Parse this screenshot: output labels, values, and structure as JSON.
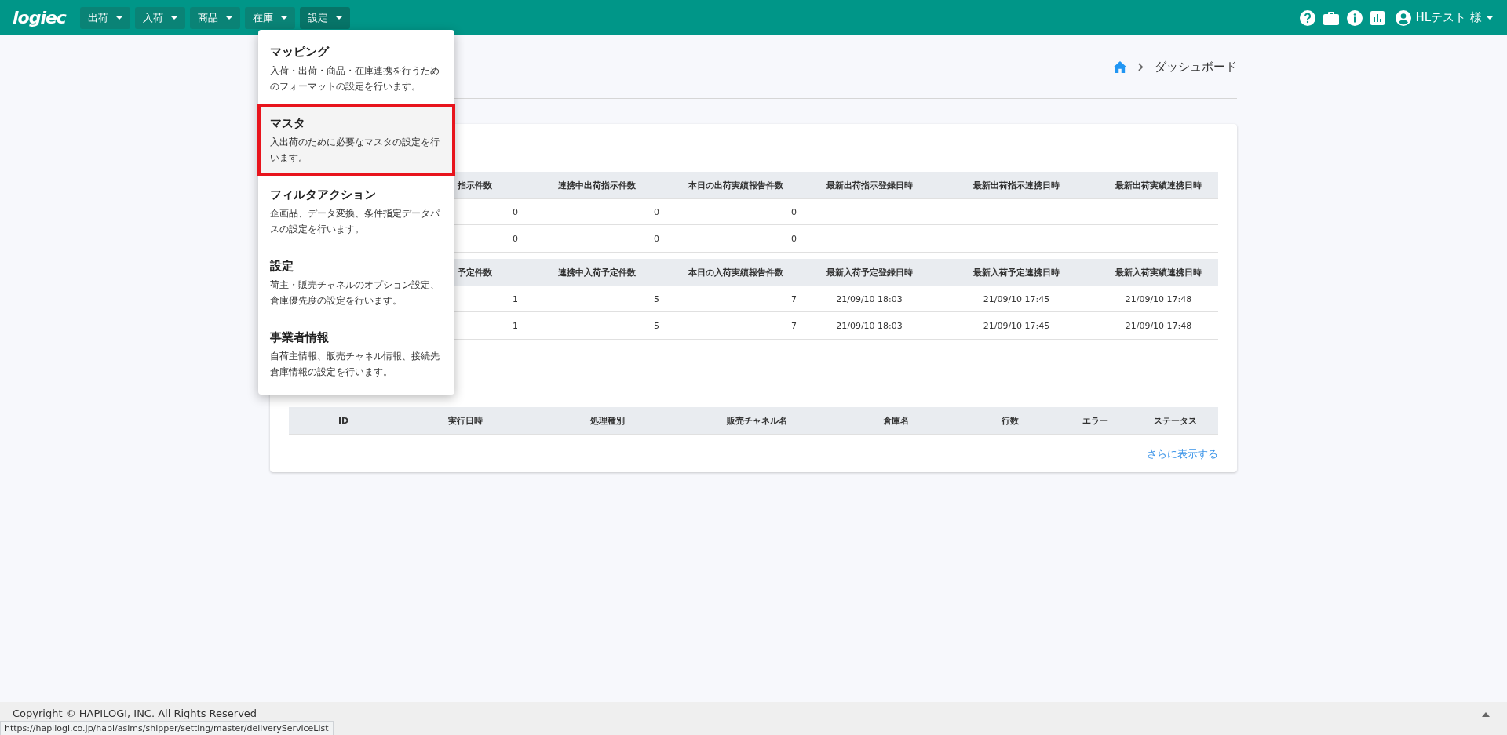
{
  "header": {
    "logo": "logiec",
    "nav": [
      {
        "label": "出荷",
        "expanded": false
      },
      {
        "label": "入荷",
        "expanded": false
      },
      {
        "label": "商品",
        "expanded": false
      },
      {
        "label": "在庫",
        "expanded": false
      },
      {
        "label": "設定",
        "expanded": true
      }
    ],
    "user": "HLテスト 様"
  },
  "settings_menu": {
    "items": [
      {
        "title": "マッピング",
        "description": "入荷・出荷・商品・在庫連携を行うためのフォーマットの設定を行います。",
        "highlighted": false
      },
      {
        "title": "マスタ",
        "description": "入出荷のために必要なマスタの設定を行います。",
        "highlighted": true
      },
      {
        "title": "フィルタアクション",
        "description": "企画品、データ変換、条件指定データパスの設定を行います。",
        "highlighted": false
      },
      {
        "title": "設定",
        "description": "荷主・販売チャネルのオプション設定、倉庫優先度の設定を行います。",
        "highlighted": false
      },
      {
        "title": "事業者情報",
        "description": "自荷主情報、販売チャネル情報、接続先倉庫情報の設定を行います。",
        "highlighted": false
      }
    ]
  },
  "breadcrumb": {
    "current": "ダッシュボード"
  },
  "shipping_table": {
    "columns": [
      "指示件数",
      "連携中出荷指示件数",
      "本日の出荷実績報告件数",
      "最新出荷指示登録日時",
      "最新出荷指示連携日時",
      "最新出荷実績連携日時"
    ],
    "rows": [
      [
        "0",
        "0",
        "0"
      ],
      [
        "0",
        "0",
        "0"
      ]
    ]
  },
  "receiving_table": {
    "columns": [
      "予定件数",
      "連携中入荷予定件数",
      "本日の入荷実績報告件数",
      "最新入荷予定登録日時",
      "最新入荷予定連携日時",
      "最新入荷実績連携日時"
    ],
    "rows": [
      [
        "1",
        "5",
        "7",
        "21/09/10 18:03",
        "21/09/10 17:45",
        "21/09/10 17:48"
      ],
      [
        "1",
        "5",
        "7",
        "21/09/10 18:03",
        "21/09/10 17:45",
        "21/09/10 17:48"
      ]
    ]
  },
  "history_table": {
    "columns": [
      "ID",
      "実行日時",
      "処理種別",
      "販売チャネル名",
      "倉庫名",
      "行数",
      "エラー",
      "ステータス"
    ],
    "more_link": "さらに表示する"
  },
  "footer": {
    "copyright": "Copyright © HAPILOGI, INC. All Rights Reserved"
  },
  "status_url": "https://hapilogi.co.jp/hapi/asims/shipper/setting/master/deliveryServiceList"
}
